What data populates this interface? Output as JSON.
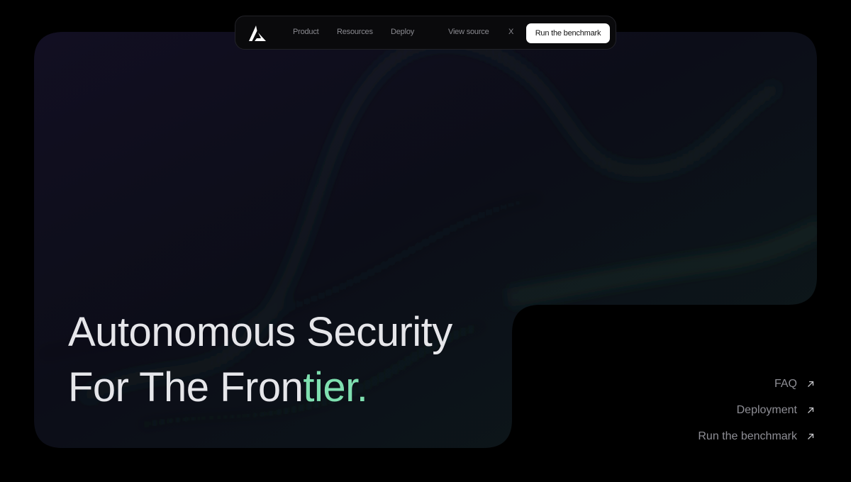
{
  "nav": {
    "logo_icon": "triangle-logo-icon",
    "links": [
      "Product",
      "Resources",
      "Deploy",
      "View source",
      "X"
    ],
    "cta_label": "Run the benchmark"
  },
  "hero": {
    "line1": "Autonomous Security",
    "line2_main": "For The Fron",
    "line2_accent": "tier.",
    "accent_color": "#7fe0b0",
    "background_icon": "particle-wave-graphic"
  },
  "side_links": [
    {
      "label": "FAQ",
      "icon": "arrow-up-right-icon"
    },
    {
      "label": "Deployment",
      "icon": "arrow-up-right-icon"
    },
    {
      "label": "Run the benchmark",
      "icon": "arrow-up-right-icon"
    }
  ],
  "colors": {
    "background": "#000000",
    "card": "#0e1018",
    "text": "#e6e6ea",
    "accent": "#7fe0b0"
  }
}
